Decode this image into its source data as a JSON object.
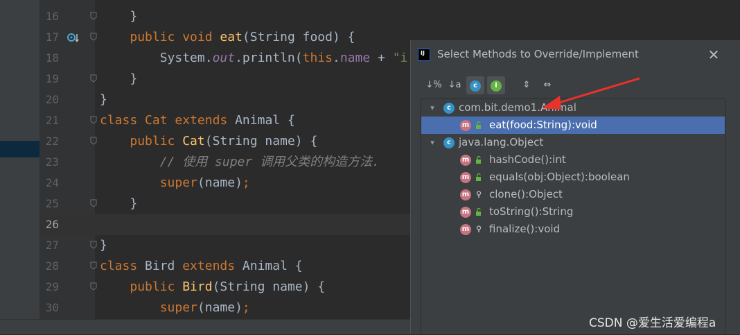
{
  "editor": {
    "lines": [
      {
        "n": "16",
        "segs": [
          {
            "t": "    }",
            "c": "p"
          }
        ]
      },
      {
        "n": "17",
        "segs": [
          {
            "t": "    ",
            "c": "p"
          },
          {
            "t": "public void ",
            "c": "kw"
          },
          {
            "t": "eat",
            "c": "fn"
          },
          {
            "t": "(String food) {",
            "c": "p"
          }
        ]
      },
      {
        "n": "18",
        "segs": [
          {
            "t": "        System.",
            "c": "p"
          },
          {
            "t": "out",
            "c": "ital"
          },
          {
            "t": ".println(",
            "c": "p"
          },
          {
            "t": "this",
            "c": "kw"
          },
          {
            "t": ".",
            "c": "p"
          },
          {
            "t": "name",
            "c": "fld"
          },
          {
            "t": " + ",
            "c": "p"
          },
          {
            "t": "\"i",
            "c": "str"
          }
        ]
      },
      {
        "n": "19",
        "segs": [
          {
            "t": "    }",
            "c": "p"
          }
        ]
      },
      {
        "n": "20",
        "segs": [
          {
            "t": "}",
            "c": "p"
          }
        ]
      },
      {
        "n": "21",
        "segs": [
          {
            "t": "class ",
            "c": "kw"
          },
          {
            "t": "Cat ",
            "c": "kw"
          },
          {
            "t": "extends ",
            "c": "kw"
          },
          {
            "t": "Animal {",
            "c": "p"
          }
        ]
      },
      {
        "n": "22",
        "segs": [
          {
            "t": "    ",
            "c": "p"
          },
          {
            "t": "public ",
            "c": "kw"
          },
          {
            "t": "Cat",
            "c": "fn"
          },
          {
            "t": "(String name) {",
            "c": "p"
          }
        ]
      },
      {
        "n": "23",
        "segs": [
          {
            "t": "        // 使用 super 调用父类的构造方法.",
            "c": "cmt"
          }
        ]
      },
      {
        "n": "24",
        "segs": [
          {
            "t": "        ",
            "c": "p"
          },
          {
            "t": "super",
            "c": "kw"
          },
          {
            "t": "(name)",
            "c": "p"
          },
          {
            "t": ";",
            "c": "kw"
          }
        ]
      },
      {
        "n": "25",
        "segs": [
          {
            "t": "    }",
            "c": "p"
          }
        ]
      },
      {
        "n": "26",
        "segs": [
          {
            "t": "",
            "c": "p"
          }
        ]
      },
      {
        "n": "27",
        "segs": [
          {
            "t": "}",
            "c": "p"
          }
        ]
      },
      {
        "n": "28",
        "segs": [
          {
            "t": "class ",
            "c": "kw"
          },
          {
            "t": "Bird ",
            "c": "p"
          },
          {
            "t": "extends ",
            "c": "kw"
          },
          {
            "t": "Animal {",
            "c": "p"
          }
        ]
      },
      {
        "n": "29",
        "segs": [
          {
            "t": "    ",
            "c": "p"
          },
          {
            "t": "public ",
            "c": "kw"
          },
          {
            "t": "Bird",
            "c": "fn"
          },
          {
            "t": "(String name) {",
            "c": "p"
          }
        ]
      },
      {
        "n": "30",
        "segs": [
          {
            "t": "        ",
            "c": "p"
          },
          {
            "t": "super",
            "c": "kw"
          },
          {
            "t": "(name)",
            "c": "p"
          },
          {
            "t": ";",
            "c": "kw"
          }
        ]
      }
    ],
    "current_line": "26"
  },
  "dialog": {
    "title": "Select Methods to Override/Implement",
    "close_icon": "close-icon",
    "toolbar": [
      {
        "name": "sort-by-visibility-icon",
        "glyph": "↓%"
      },
      {
        "name": "sort-alphabetically-icon",
        "glyph": "↓a"
      },
      {
        "name": "show-classes-icon",
        "glyph": "c"
      },
      {
        "name": "show-interfaces-icon",
        "glyph": "I"
      },
      {
        "name": "expand-all-icon",
        "glyph": "⇕"
      },
      {
        "name": "collapse-all-icon",
        "glyph": "⇔"
      }
    ],
    "tree": [
      {
        "type": "class",
        "label": "com.bit.demo1.Animal",
        "expanded": true
      },
      {
        "type": "method",
        "label": "eat(food:String):void",
        "access": "public",
        "selected": true
      },
      {
        "type": "class",
        "label": "java.lang.Object",
        "expanded": true
      },
      {
        "type": "method",
        "label": "hashCode():int",
        "access": "public"
      },
      {
        "type": "method",
        "label": "equals(obj:Object):boolean",
        "access": "public"
      },
      {
        "type": "method",
        "label": "clone():Object",
        "access": "protected"
      },
      {
        "type": "method",
        "label": "toString():String",
        "access": "public"
      },
      {
        "type": "method",
        "label": "finalize():void",
        "access": "protected"
      }
    ]
  },
  "watermark": "CSDN @爱生活爱编程a",
  "colors": {
    "annotation_arrow": "#e8332a",
    "selection": "#4b6eaf"
  }
}
